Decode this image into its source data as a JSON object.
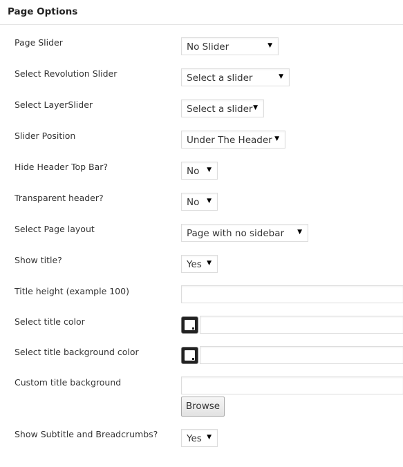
{
  "header": {
    "title": "Page Options"
  },
  "fields": [
    {
      "label": "Page Slider",
      "value": "No Slider"
    },
    {
      "label": "Select Revolution Slider",
      "value": "Select a slider"
    },
    {
      "label": "Select LayerSlider",
      "value": "Select a slider"
    },
    {
      "label": "Slider Position",
      "value": "Under The Header"
    },
    {
      "label": "Hide Header Top Bar?",
      "value": "No"
    },
    {
      "label": "Transparent header?",
      "value": "No"
    },
    {
      "label": "Select Page layout",
      "value": "Page with no sidebar"
    },
    {
      "label": "Show title?",
      "value": "Yes"
    },
    {
      "label": "Title height (example 100)",
      "value": ""
    },
    {
      "label": "Select title color",
      "value": ""
    },
    {
      "label": "Select title background color",
      "value": ""
    },
    {
      "label": "Custom title background",
      "value": "",
      "button": "Browse"
    },
    {
      "label": "Show Subtitle and Breadcrumbs?",
      "value": "Yes"
    }
  ]
}
